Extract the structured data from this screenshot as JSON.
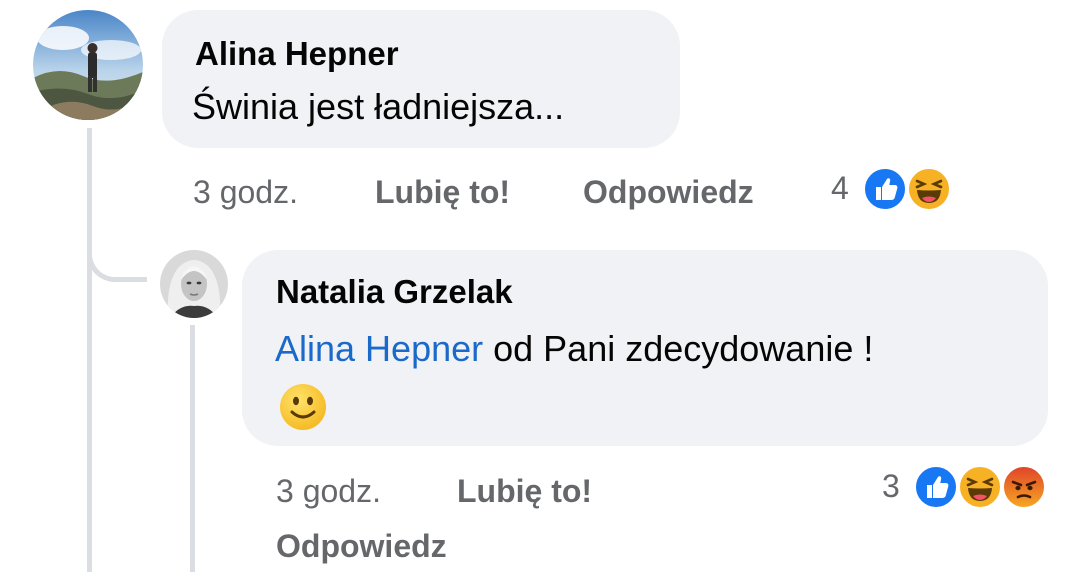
{
  "comment": {
    "author": "Alina Hepner",
    "text": "Świnia jest ładniejsza...",
    "time": "3 godz.",
    "like_label": "Lubię to!",
    "reply_label": "Odpowiedz",
    "reaction_count": "4",
    "reactions": [
      "like-icon",
      "haha-icon"
    ]
  },
  "reply": {
    "author": "Natalia Grzelak",
    "mention": "Alina Hepner",
    "text": " od Pani zdecydowanie !",
    "emoji": "slightly-smiling-face-icon",
    "time": "3 godz.",
    "like_label": "Lubię to!",
    "reply_label": "Odpowiedz",
    "reaction_count": "3",
    "reactions": [
      "like-icon",
      "haha-icon",
      "angry-icon"
    ]
  },
  "colors": {
    "bubble": "#f0f2f5",
    "mention": "#1b6ac9",
    "meta": "#65676b",
    "like": "#1877f2",
    "haha": "#f7b125",
    "angry": "#e9710f"
  }
}
